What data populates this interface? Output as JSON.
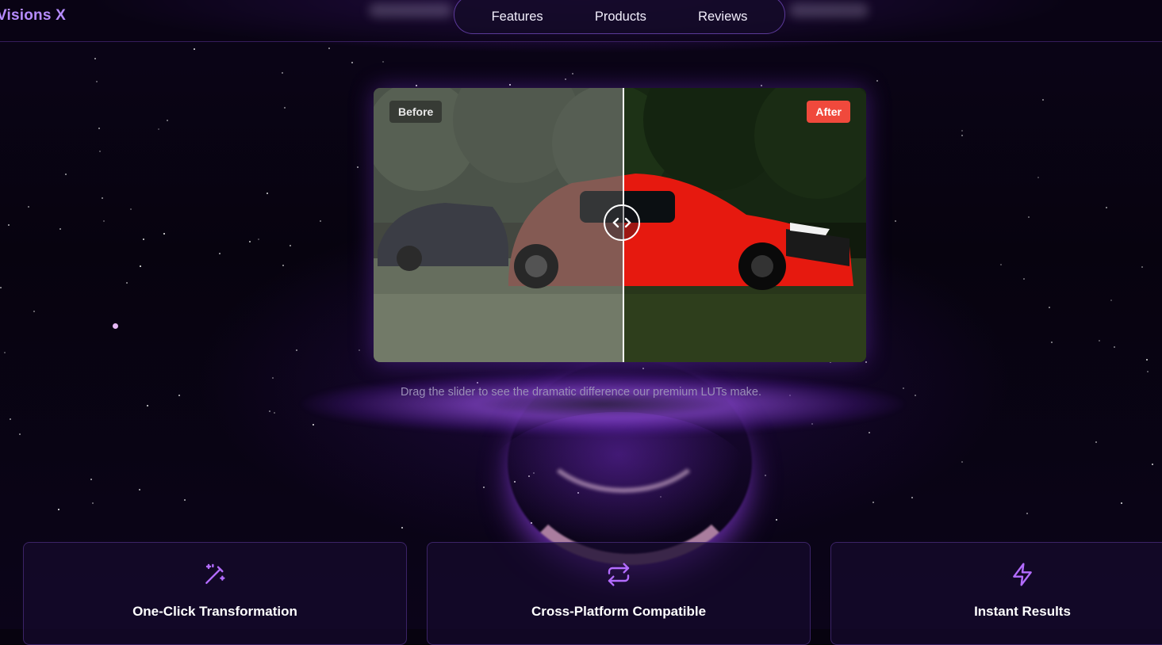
{
  "header": {
    "logo": "Visions X",
    "nav": [
      {
        "label": "Features"
      },
      {
        "label": "Products"
      },
      {
        "label": "Reviews"
      }
    ]
  },
  "comparison": {
    "before_label": "Before",
    "after_label": "After",
    "slider_position": 0.505
  },
  "caption": "Drag the slider to see the dramatic difference our premium LUTs make.",
  "features": [
    {
      "icon": "magic-wand-icon",
      "title": "One-Click Transformation"
    },
    {
      "icon": "repeat-arrows-icon",
      "title": "Cross-Platform Compatible"
    },
    {
      "icon": "lightning-icon",
      "title": "Instant Results"
    }
  ],
  "colors": {
    "accent": "#b68cff",
    "after_badge": "#f0493c",
    "background": "#07030f"
  }
}
